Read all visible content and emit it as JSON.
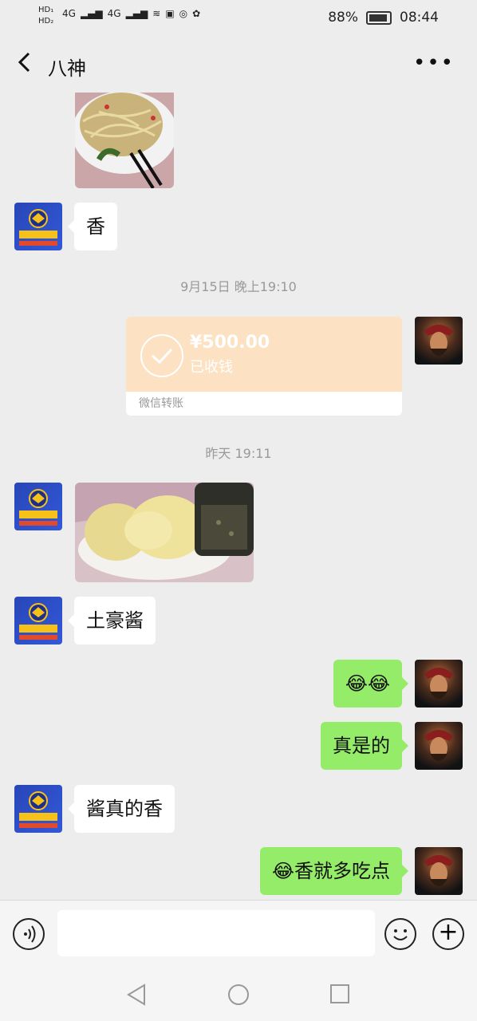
{
  "statusbar": {
    "hd_labels": [
      "HD₁",
      "HD₂"
    ],
    "network": [
      "4G",
      "4G"
    ],
    "battery": "88%",
    "time": "08:44"
  },
  "header": {
    "title": "八神",
    "back_icon": "chevron-left-icon",
    "more_icon": "more-dots-icon"
  },
  "messages": [
    {
      "type": "image",
      "side": "left",
      "subject": "noodles"
    },
    {
      "type": "text",
      "side": "left",
      "text": "香"
    },
    {
      "type": "timestamp",
      "text": "9月15日 晚上19:10"
    },
    {
      "type": "transfer",
      "side": "right",
      "amount": "¥500.00",
      "status": "已收钱",
      "label": "微信转账"
    },
    {
      "type": "timestamp",
      "text": "昨天 19:11"
    },
    {
      "type": "image",
      "side": "left",
      "subject": "steamed-buns"
    },
    {
      "type": "text",
      "side": "left",
      "text": "土豪酱"
    },
    {
      "type": "text",
      "side": "right",
      "text": "😂😂"
    },
    {
      "type": "text",
      "side": "right",
      "text": "真是的"
    },
    {
      "type": "text",
      "side": "left",
      "text": "酱真的香"
    },
    {
      "type": "text",
      "side": "right",
      "text": "😂香就多吃点"
    }
  ],
  "inputbar": {
    "voice_icon": "voice-icon",
    "emoji_icon": "emoji-icon",
    "plus_icon": "plus-icon",
    "input_value": ""
  },
  "colors": {
    "background": "#ededed",
    "bubble_self": "#95ec69",
    "bubble_other": "#ffffff",
    "transfer": "#fce1c2"
  }
}
